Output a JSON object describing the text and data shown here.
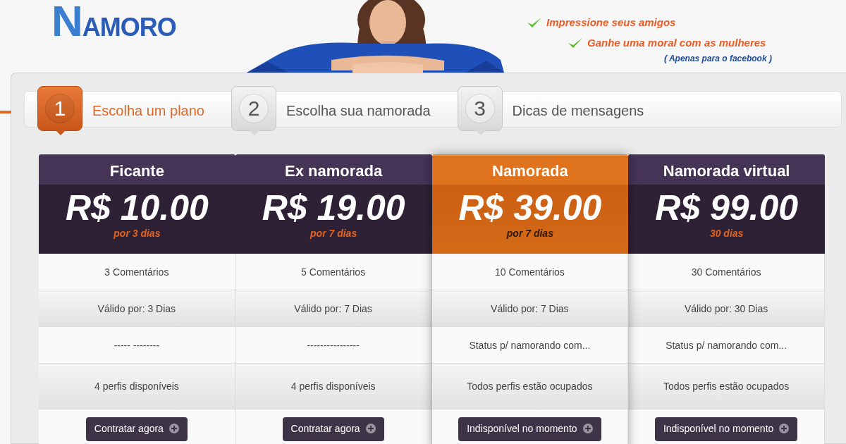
{
  "logo": {
    "text": "NAMORO"
  },
  "header": {
    "picture": {
      "kind": "picture"
    },
    "taglines": [
      "Impressione seus amigos",
      "Ganhe uma moral com as mulheres"
    ],
    "note": "( Apenas para o facebook )"
  },
  "steps": [
    {
      "number": "1",
      "label": "Escolha um plano",
      "selected": true
    },
    {
      "number": "2",
      "label": "Escolha sua namorada",
      "selected": false
    },
    {
      "number": "3",
      "label": "Dicas de mensagens",
      "selected": false
    }
  ],
  "plans": [
    {
      "name": "Ficante",
      "price": "R$ 10.00",
      "period": "por 3 dias",
      "featured": false,
      "features": [
        "3 Comentários",
        "Válido por: 3 Dias",
        "----- --------",
        "4 perfis disponíveis"
      ],
      "button": "Contratar agora"
    },
    {
      "name": "Ex namorada",
      "price": "R$ 19.00",
      "period": "por 7 dias",
      "featured": false,
      "features": [
        "5 Comentários",
        "Válido por: 7 Dias",
        "----------------",
        "4 perfis disponíveis"
      ],
      "button": "Contratar agora"
    },
    {
      "name": "Namorada",
      "price": "R$ 39.00",
      "period": "por 7 dias",
      "featured": true,
      "features": [
        "10 Comentários",
        "Válido por: 7 Dias",
        "Status p/ namorando com...",
        "Todos perfis estão ocupados"
      ],
      "button": "Indisponível no momento"
    },
    {
      "name": "Namorada virtual",
      "price": "R$ 99.00",
      "period": "30 dias",
      "featured": false,
      "features": [
        "30 Comentários",
        "Válido por: 30 Dias",
        "Status p/ namorando com...",
        "Todos perfis estão ocupados"
      ],
      "button": "Indisponível no momento"
    }
  ]
}
